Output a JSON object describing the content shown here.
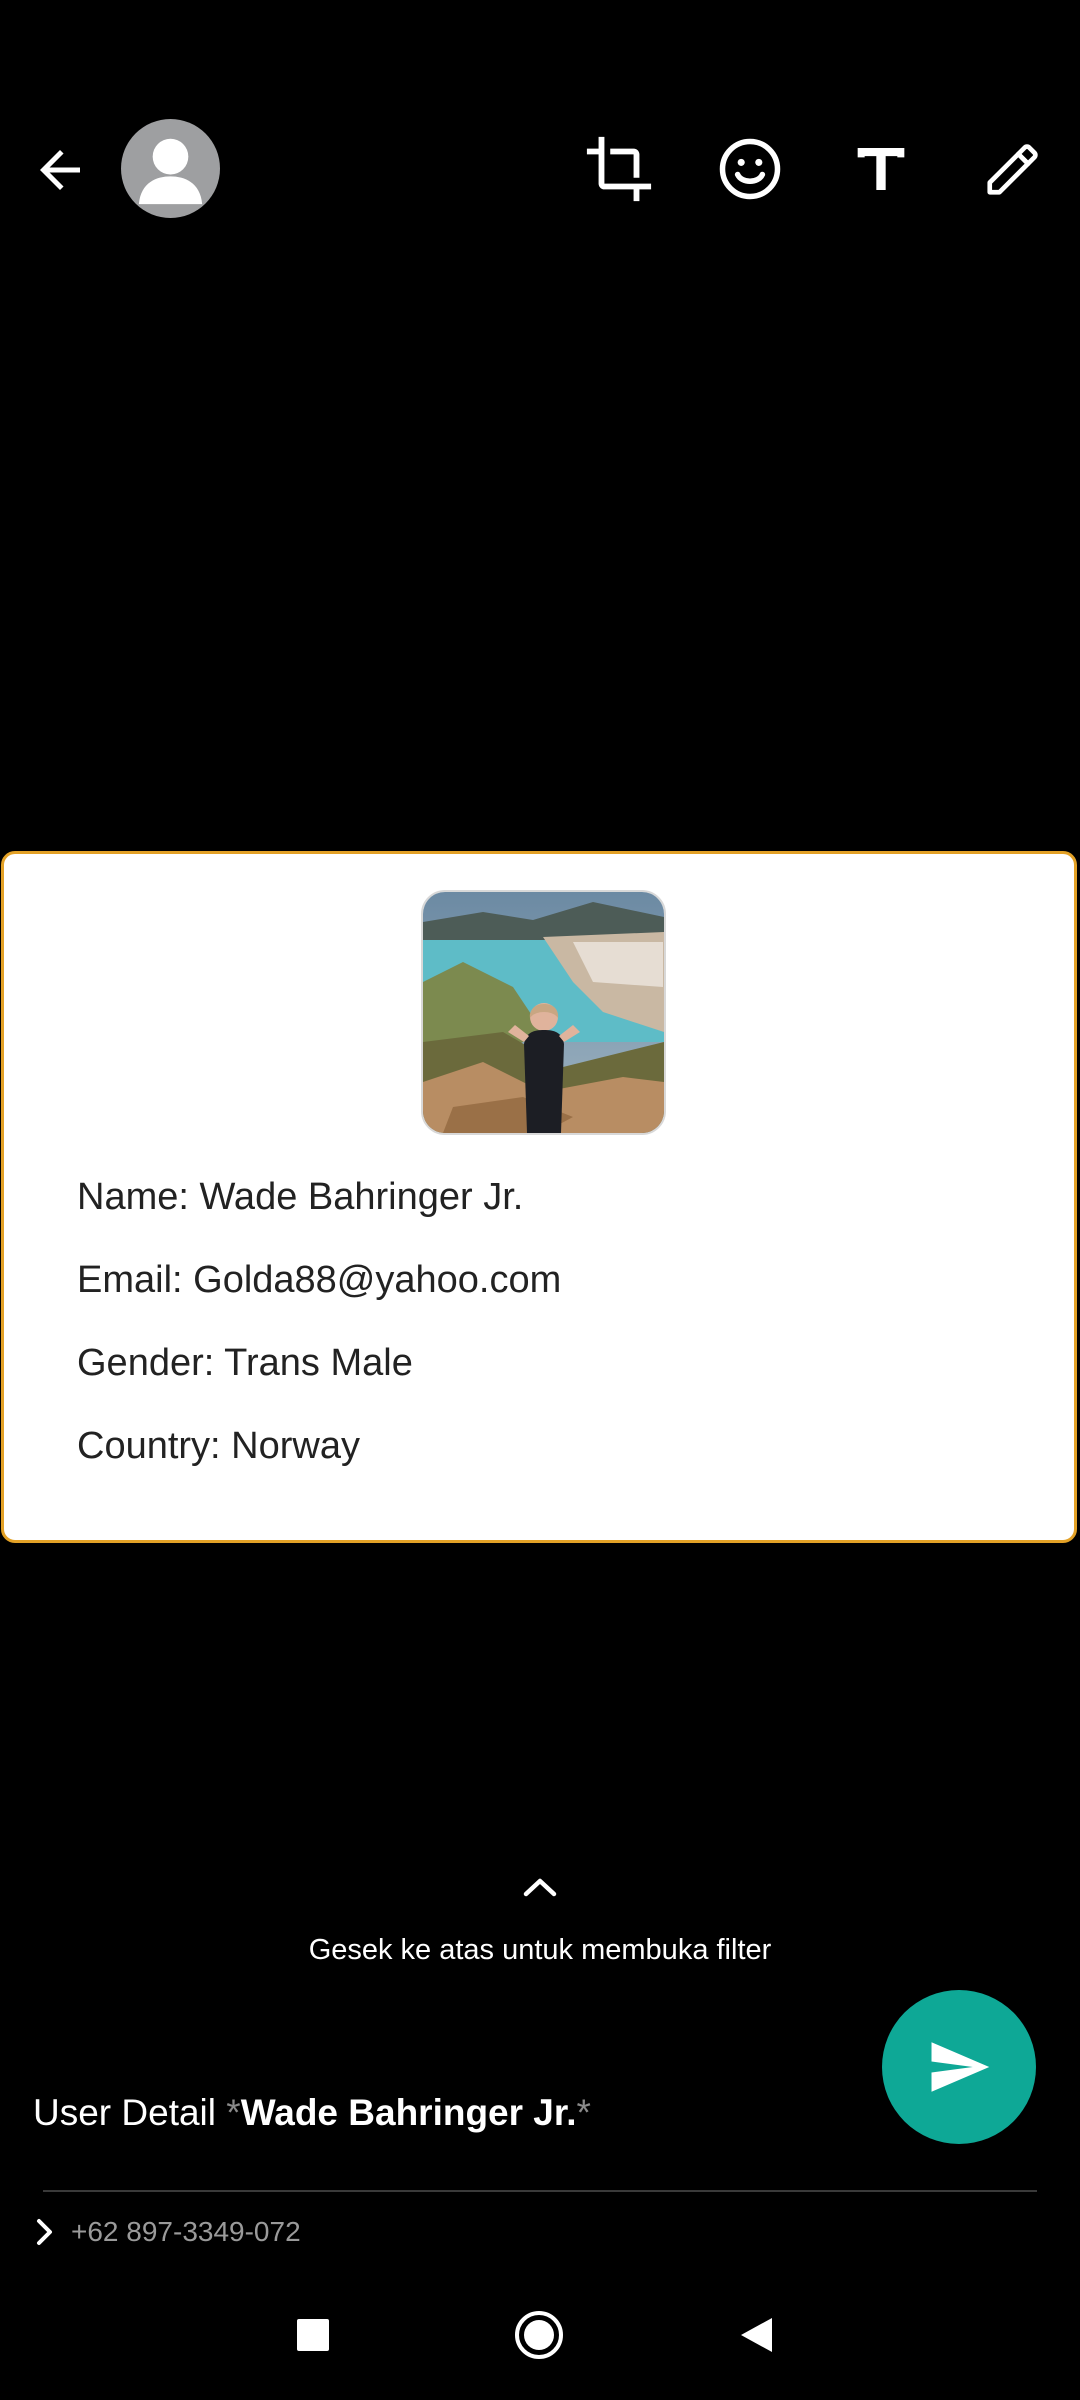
{
  "header": {
    "back_icon": "arrow-left-icon",
    "avatar_icon": "person-icon",
    "tools": [
      "crop-rotate-icon",
      "emoji-icon",
      "text-icon",
      "pencil-icon"
    ]
  },
  "card": {
    "lines": [
      "Name: Wade Bahringer Jr.",
      "Email: Golda88@yahoo.com",
      "Gender: Trans Male",
      "Country: Norway"
    ]
  },
  "swipe": {
    "hint": "Gesek ke atas untuk membuka filter"
  },
  "caption": {
    "prefix": "User Detail ",
    "star_open": "*",
    "name": "Wade Bahringer Jr.",
    "star_close": "*"
  },
  "recipient": {
    "number": "+62 897-3349-072"
  },
  "colors": {
    "send": "#0ea896",
    "card_border": "#e3a126"
  }
}
